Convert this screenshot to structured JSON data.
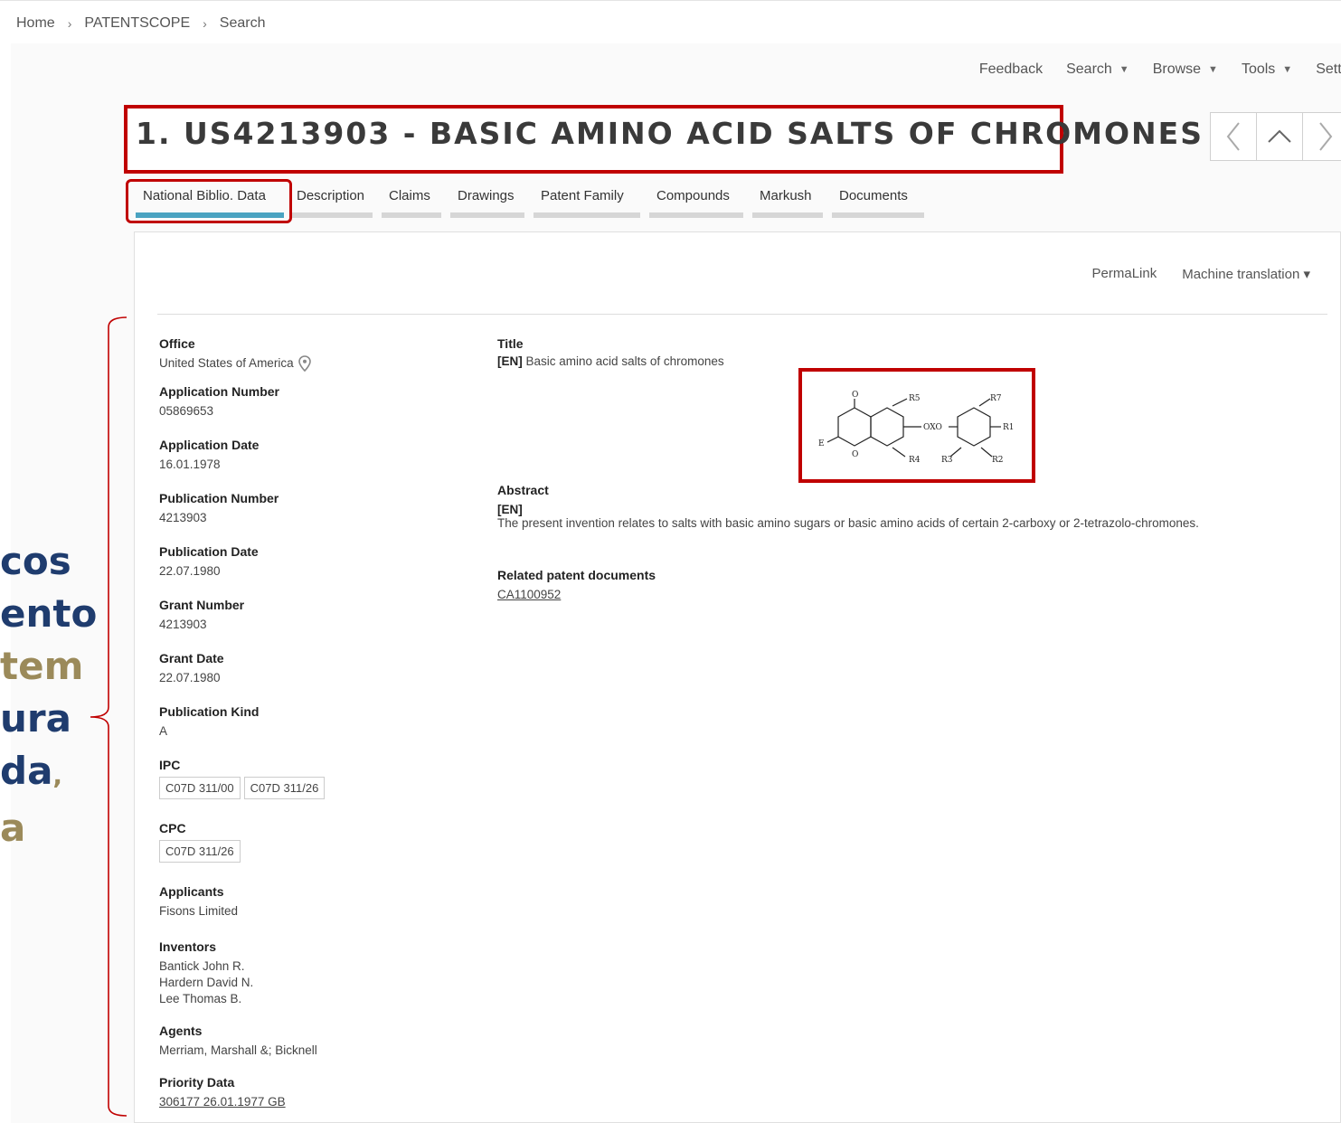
{
  "breadcrumb": [
    "Home",
    "PATENTSCOPE",
    "Search"
  ],
  "topnav": [
    {
      "label": "Feedback",
      "dropdown": false
    },
    {
      "label": "Search",
      "dropdown": true
    },
    {
      "label": "Browse",
      "dropdown": true
    },
    {
      "label": "Tools",
      "dropdown": true
    },
    {
      "label": "Settings",
      "dropdown": false
    }
  ],
  "title": "1. US4213903 - BASIC AMINO ACID SALTS OF CHROMONES",
  "tabs": [
    "National Biblio. Data",
    "Description",
    "Claims",
    "Drawings",
    "Patent Family",
    "Compounds",
    "Markush",
    "Documents"
  ],
  "active_tab": "National Biblio. Data",
  "panel_actions": {
    "permalink": "PermaLink",
    "translation": "Machine translation ▾"
  },
  "biblio": {
    "office_label": "Office",
    "office": "United States of America",
    "appnum_label": "Application Number",
    "appnum": "05869653",
    "appdate_label": "Application Date",
    "appdate": "16.01.1978",
    "pubnum_label": "Publication Number",
    "pubnum": "4213903",
    "pubdate_label": "Publication Date",
    "pubdate": "22.07.1980",
    "grantnum_label": "Grant Number",
    "grantnum": "4213903",
    "grantdate_label": "Grant Date",
    "grantdate": "22.07.1980",
    "kind_label": "Publication Kind",
    "kind": "A",
    "ipc_label": "IPC",
    "ipc": [
      "C07D 311/00",
      "C07D 311/26"
    ],
    "cpc_label": "CPC",
    "cpc": [
      "C07D 311/26"
    ],
    "applicants_label": "Applicants",
    "applicants": "Fisons Limited",
    "inventors_label": "Inventors",
    "inventors": [
      "Bantick John R.",
      "Hardern David N.",
      "Lee Thomas B."
    ],
    "agents_label": "Agents",
    "agents": "Merriam, Marshall &; Bicknell",
    "priority_label": "Priority Data",
    "priority": "306177 26.01.1977 GB"
  },
  "right": {
    "title_label": "Title",
    "title_lang": "[EN]",
    "title_text": "Basic amino acid salts of chromones",
    "abstract_label": "Abstract",
    "abstract_lang": "[EN]",
    "abstract_text": "The present invention relates to salts with basic amino sugars or basic amino acids of certain 2-carboxy or 2-tetrazolo-chromones.",
    "related_label": "Related patent documents",
    "related_link": "CA1100952"
  },
  "side_text": [
    {
      "text": "cos",
      "color": "blue"
    },
    {
      "text": "ento",
      "color": "blue"
    },
    {
      "text": "tem",
      "color": "olive"
    },
    {
      "text": "ura",
      "color": "blue"
    },
    {
      "text": "da",
      "color": "blue",
      "suffix": ","
    },
    {
      "text": "a",
      "color": "olive"
    }
  ],
  "chem_labels": [
    "O",
    "E",
    "O",
    "R5",
    "R4",
    "OXO",
    "R3",
    "R7",
    "R1",
    "R2"
  ],
  "colors": {
    "highlight": "#c00000",
    "tab_active": "#4aa3c1",
    "side_blue": "#1f3c6e",
    "side_olive": "#9b8a5a"
  }
}
